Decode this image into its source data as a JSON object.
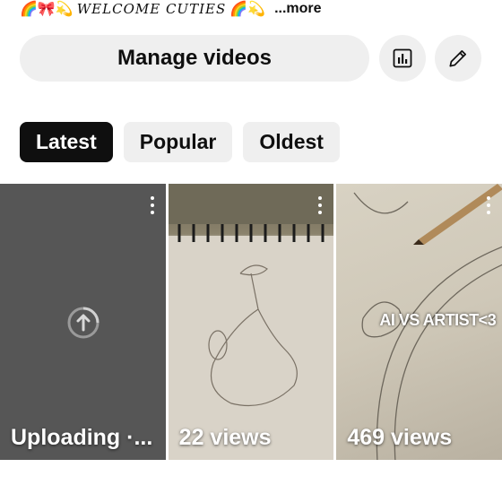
{
  "bio": {
    "prefix_emoji": "🌈🎀💫",
    "text": "WELCOME CUTIES",
    "suffix_emoji": "🌈💫",
    "more": "...more"
  },
  "actions": {
    "manage_videos": "Manage videos",
    "stats_icon": "bar-chart-icon",
    "edit_icon": "pencil-icon"
  },
  "filters": {
    "selected": "Latest",
    "chips": [
      "Latest",
      "Popular",
      "Oldest"
    ]
  },
  "videos": [
    {
      "caption": "Uploading ·...",
      "overlay": "",
      "status_icon": "upload-arrow-icon"
    },
    {
      "caption": "22 views",
      "overlay": ""
    },
    {
      "caption": "469 views",
      "overlay": "AI VS ARTIST<3"
    }
  ]
}
